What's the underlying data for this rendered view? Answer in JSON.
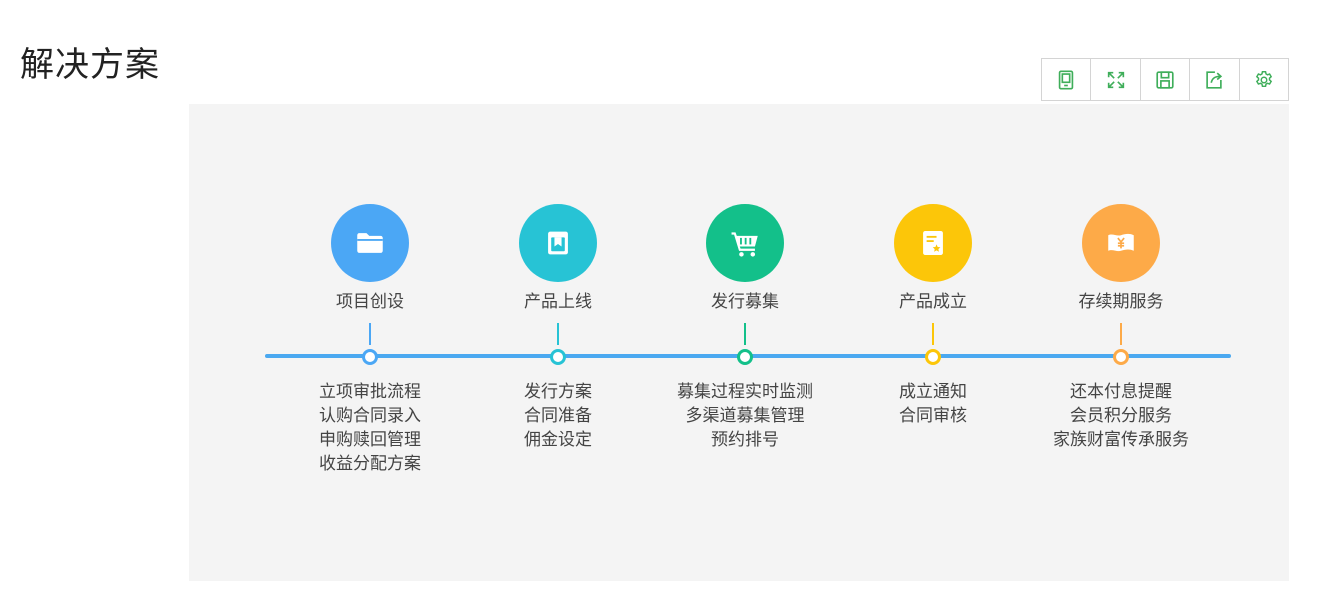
{
  "page": {
    "title": "解决方案"
  },
  "toolbar": {
    "color": "#3fae5a",
    "tools": [
      {
        "icon": "tablet-icon"
      },
      {
        "icon": "fullscreen-icon"
      },
      {
        "icon": "save-icon"
      },
      {
        "icon": "share-icon"
      },
      {
        "icon": "gear-icon"
      }
    ]
  },
  "timeline": {
    "line_color": "#4aa8f0",
    "stages": [
      {
        "title": "项目创设",
        "color": "#4ba7f5",
        "icon": "folder-icon",
        "items": [
          "立项审批流程",
          "认购合同录入",
          "申购赎回管理",
          "收益分配方案"
        ]
      },
      {
        "title": "产品上线",
        "color": "#27c3d5",
        "icon": "bookmark-book-icon",
        "items": [
          "发行方案",
          "合同准备",
          "佣金设定"
        ]
      },
      {
        "title": "发行募集",
        "color": "#13c08a",
        "icon": "shopping-cart-icon",
        "items": [
          "募集过程实时监测",
          "多渠道募集管理",
          "预约排号"
        ]
      },
      {
        "title": "产品成立",
        "color": "#fcc609",
        "icon": "certificate-icon",
        "items": [
          "成立通知",
          "合同审核"
        ]
      },
      {
        "title": "存续期服务",
        "color": "#fdaa48",
        "icon": "yuan-banknote-icon",
        "items": [
          "还本付息提醒",
          "会员积分服务",
          "家族财富传承服务"
        ]
      }
    ]
  }
}
